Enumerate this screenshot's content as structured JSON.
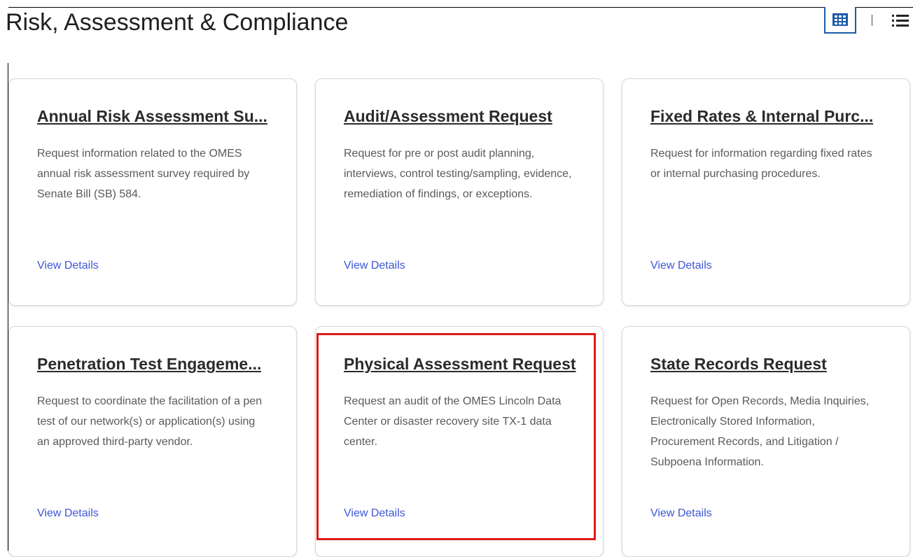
{
  "header": {
    "title": "Risk, Assessment & Compliance"
  },
  "view_toggle": {
    "grid_icon": "grid-view-icon",
    "list_icon": "list-view-icon",
    "active_color": "#1e5aa8"
  },
  "cards": [
    {
      "title": "Annual Risk Assessment Su...",
      "description": "Request information related to the OMES annual risk assessment survey required by Senate Bill (SB) 584.",
      "link": "View Details"
    },
    {
      "title": "Audit/Assessment Request",
      "description": "Request for pre or post audit planning, interviews, control testing/sampling, evidence, remediation of findings, or exceptions.",
      "link": "View Details"
    },
    {
      "title": "Fixed Rates & Internal Purc...",
      "description": "Request for information regarding fixed rates or internal purchasing procedures.",
      "link": "View Details"
    },
    {
      "title": "Penetration Test Engageme...",
      "description": "Request to coordinate the facilitation of a pen test of our network(s) or application(s) using an approved third-party vendor.",
      "link": "View Details"
    },
    {
      "title": "Physical Assessment Request",
      "description": "Request an audit of the OMES Lincoln Data Center or disaster recovery site TX-1 data center.",
      "link": "View Details"
    },
    {
      "title": "State Records Request",
      "description": "Request for Open Records, Media Inquiries, Electronically Stored Information, Procurement Records, and Litigation / Subpoena Information.",
      "link": "View Details"
    }
  ],
  "highlight_color": "#e01919",
  "link_color": "#3d57d6"
}
